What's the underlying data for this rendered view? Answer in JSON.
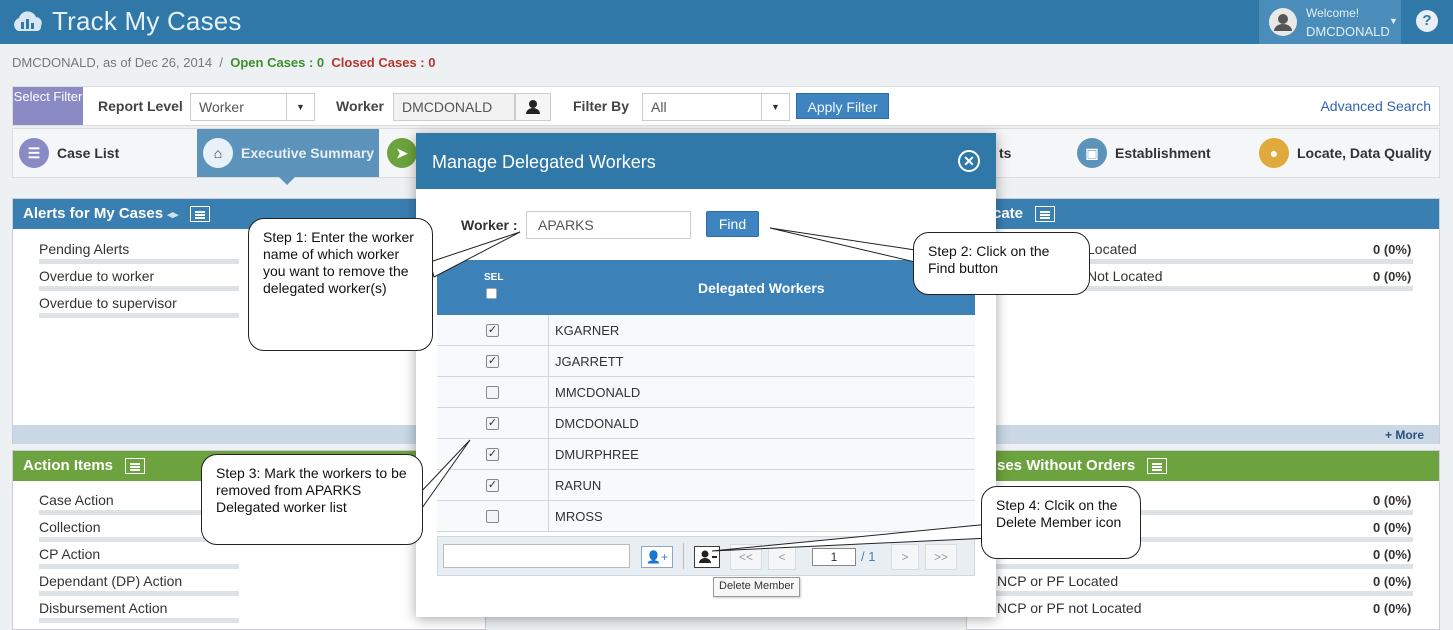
{
  "app": {
    "title": "Track My Cases",
    "welcome": "Welcome!",
    "username": "DMCDONALD",
    "help": "?"
  },
  "status": {
    "prefix": "DMCDONALD, as of Dec 26, 2014",
    "sep": "/",
    "open": "Open Cases : 0",
    "closed": "Closed Cases : 0"
  },
  "filter": {
    "select_filter": "Select Filter",
    "report_level_label": "Report Level",
    "report_level_value": "Worker",
    "worker_label": "Worker",
    "worker_value": "DMCDONALD",
    "filter_by_label": "Filter By",
    "filter_by_value": "All",
    "apply": "Apply Filter",
    "advanced": "Advanced Search"
  },
  "tabs": [
    {
      "label": "Case List",
      "color": "#8a8ac4"
    },
    {
      "label": "Executive Summary",
      "color": "#e8f1f7"
    },
    {
      "label": "ts",
      "color": "#6ca33e"
    },
    {
      "label": "Establishment",
      "color": "#5b93bb"
    },
    {
      "label": "Locate, Data Quality",
      "color": "#e0a93b"
    }
  ],
  "panels": {
    "alerts": {
      "title": "Alerts for My Cases",
      "arrows": "◂▸",
      "rows": [
        "Pending Alerts",
        "Overdue to worker",
        "Overdue to supervisor"
      ],
      "more": "+ More"
    },
    "locate": {
      "title": "cate",
      "rows": [
        "Located",
        "Not Located"
      ],
      "values": [
        "0 (0%)",
        "0 (0%)"
      ]
    },
    "actions": {
      "title": "Action Items",
      "rows": [
        "Case Action",
        "Collection",
        "CP Action",
        "Dependant (DP) Action",
        "Disbursement Action"
      ]
    },
    "no_orders": {
      "title": "ses Without Orders",
      "rows": [
        "",
        "",
        "",
        "NCP or PF Located",
        "NCP or PF not Located"
      ],
      "values": [
        "0 (0%)",
        "0 (0%)",
        "0 (0%)",
        "0 (0%)",
        "0 (0%)"
      ]
    }
  },
  "modal": {
    "title": "Manage Delegated Workers",
    "worker_label": "Worker :",
    "worker_value": "APARKS",
    "find": "Find",
    "sel_header": "SEL",
    "list_header": "Delegated Workers",
    "rows": [
      {
        "name": "KGARNER",
        "checked": true
      },
      {
        "name": "JGARRETT",
        "checked": true
      },
      {
        "name": "MMCDONALD",
        "checked": false
      },
      {
        "name": "DMCDONALD",
        "checked": true
      },
      {
        "name": "DMURPHREE",
        "checked": true
      },
      {
        "name": "RARUN",
        "checked": true
      },
      {
        "name": "MROSS",
        "checked": false
      }
    ],
    "pager": {
      "first": "<<",
      "prev": "<",
      "page": "1",
      "total": "/ 1",
      "next": ">",
      "last": ">>"
    },
    "tooltip": "Delete Member"
  },
  "callouts": {
    "step1": "Step 1: Enter the worker name of which worker you want to remove the delegated worker(s)",
    "step2": "Step 2: Click on the Find button",
    "step3": "Step 3: Mark the workers to be removed from APARKS Delegated worker list",
    "step4": "Step 4: Clcik on the Delete Member icon"
  },
  "colors": {
    "header": "#2f78a8",
    "blue_panel": "#3a7fb1",
    "green_panel": "#6ca33e",
    "button": "#3d84c1"
  }
}
